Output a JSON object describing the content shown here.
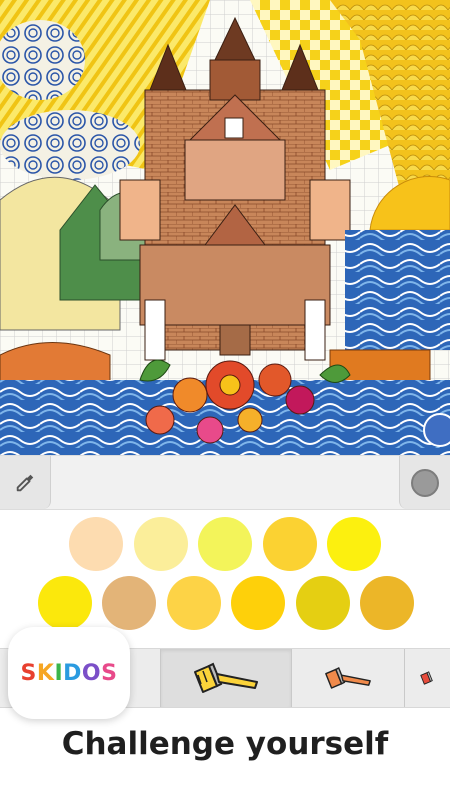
{
  "app": {
    "brand": "SKIDOS",
    "brand_letters": [
      {
        "char": "S",
        "color": "#e8402f"
      },
      {
        "char": "K",
        "color": "#f6a623"
      },
      {
        "char": "I",
        "color": "#3bb54a"
      },
      {
        "char": "D",
        "color": "#2b9be0"
      },
      {
        "char": "O",
        "color": "#7b4fc8"
      },
      {
        "char": "S",
        "color": "#e84a8a"
      }
    ]
  },
  "toolbar": {
    "left_tool_icon": "eyedropper-icon",
    "right_tool_icon": "color-preview-icon",
    "current_color": "#9a9a9a"
  },
  "palette": {
    "row1": [
      "#fddcb0",
      "#fbee9a",
      "#f3f45a",
      "#fbd232",
      "#fcf00f"
    ],
    "row2": [
      "#fbe80c",
      "#e3b478",
      "#fdd346",
      "#fed00a",
      "#e5cf12",
      "#ecb628"
    ]
  },
  "brushes": [
    {
      "icon": "paint-brush-icon",
      "color": "#fbd33a",
      "active": true
    },
    {
      "icon": "paint-brush-icon",
      "color": "#f08a4b",
      "active": false
    },
    {
      "icon": "paint-brush-icon",
      "color": "#e74c3c",
      "active": false
    }
  ],
  "tagline": "Challenge yourself"
}
